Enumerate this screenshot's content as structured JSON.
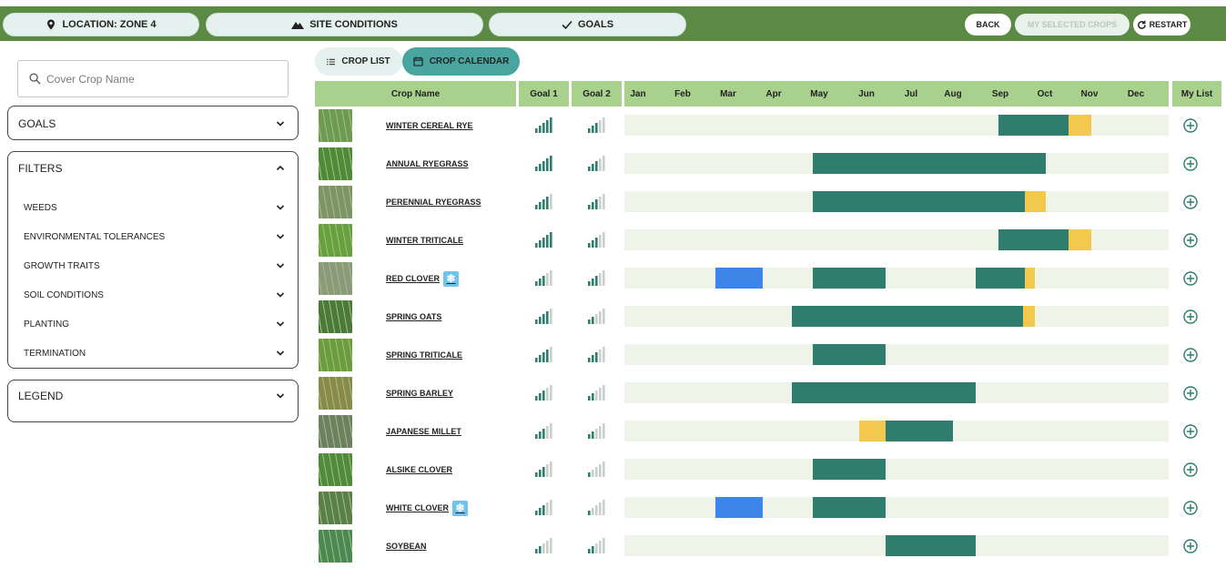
{
  "topbar": {
    "location_label": "LOCATION: ZONE 4",
    "site_conditions_label": "SITE CONDITIONS",
    "goals_label": "GOALS",
    "back_label": "BACK",
    "my_selected_crops_label": "MY SELECTED CROPS",
    "restart_label": "RESTART"
  },
  "sidebar": {
    "search_placeholder": "Cover Crop Name",
    "goals_label": "GOALS",
    "filters_label": "FILTERS",
    "filters": [
      "WEEDS",
      "ENVIRONMENTAL TOLERANCES",
      "GROWTH TRAITS",
      "SOIL CONDITIONS",
      "PLANTING",
      "TERMINATION"
    ],
    "legend_label": "LEGEND"
  },
  "view_tabs": {
    "crop_list": "CROP LIST",
    "crop_calendar": "CROP CALENDAR",
    "active": "crop_calendar"
  },
  "table": {
    "headers": {
      "crop_name": "Crop Name",
      "goal1": "Goal 1",
      "goal2": "Goal 2",
      "my_list": "My List"
    },
    "months": [
      "Jan",
      "Feb",
      "Mar",
      "Apr",
      "May",
      "Jun",
      "Jul",
      "Aug",
      "Sep",
      "Oct",
      "Nov",
      "Dec"
    ],
    "colors": {
      "growing": "#2e7d6f",
      "reliable_establishment": "#f2c94c",
      "frost_seeding": "#3d85e8",
      "track": "#eef5e8"
    },
    "crops": [
      {
        "name": "WINTER CEREAL RYE",
        "frost": false,
        "goal1": 5,
        "goal2": 3,
        "thumb": "#6f9a52",
        "segments": [
          {
            "type": "growing",
            "start": 8.25,
            "end": 9.8
          },
          {
            "type": "reliable_establishment",
            "start": 9.8,
            "end": 10.3
          }
        ]
      },
      {
        "name": "ANNUAL RYEGRASS",
        "frost": false,
        "goal1": 5,
        "goal2": 3,
        "thumb": "#4e8a37",
        "segments": [
          {
            "type": "growing",
            "start": 4.15,
            "end": 9.3
          }
        ]
      },
      {
        "name": "PERENNIAL RYEGRASS",
        "frost": false,
        "goal1": 4,
        "goal2": 3,
        "thumb": "#7f9368",
        "segments": [
          {
            "type": "growing",
            "start": 4.15,
            "end": 8.82
          },
          {
            "type": "reliable_establishment",
            "start": 8.82,
            "end": 9.3
          }
        ]
      },
      {
        "name": "WINTER TRITICALE",
        "frost": false,
        "goal1": 5,
        "goal2": 3,
        "thumb": "#67a13c",
        "segments": [
          {
            "type": "growing",
            "start": 8.25,
            "end": 9.8
          },
          {
            "type": "reliable_establishment",
            "start": 9.8,
            "end": 10.3
          }
        ]
      },
      {
        "name": "RED CLOVER",
        "frost": true,
        "goal1": 3,
        "goal2": 3,
        "thumb": "#8b9a7a",
        "segments": [
          {
            "type": "frost_seeding",
            "start": 2.0,
            "end": 3.05
          },
          {
            "type": "growing",
            "start": 4.15,
            "end": 5.75
          },
          {
            "type": "growing",
            "start": 7.75,
            "end": 8.82
          },
          {
            "type": "reliable_establishment",
            "start": 8.82,
            "end": 9.05
          }
        ]
      },
      {
        "name": "SPRING OATS",
        "frost": false,
        "goal1": 4,
        "goal2": 2,
        "thumb": "#4a7a3a",
        "segments": [
          {
            "type": "growing",
            "start": 3.7,
            "end": 8.78
          },
          {
            "type": "reliable_establishment",
            "start": 8.78,
            "end": 9.05
          }
        ]
      },
      {
        "name": "SPRING TRITICALE",
        "frost": false,
        "goal1": 4,
        "goal2": 3,
        "thumb": "#6c9c3d",
        "segments": [
          {
            "type": "growing",
            "start": 4.15,
            "end": 5.75
          }
        ]
      },
      {
        "name": "SPRING BARLEY",
        "frost": false,
        "goal1": 3,
        "goal2": 2,
        "thumb": "#8a8a4a",
        "segments": [
          {
            "type": "growing",
            "start": 3.7,
            "end": 7.75
          }
        ]
      },
      {
        "name": "JAPANESE MILLET",
        "frost": false,
        "goal1": 3,
        "goal2": 2,
        "thumb": "#6e7f62",
        "segments": [
          {
            "type": "reliable_establishment",
            "start": 5.18,
            "end": 5.75
          },
          {
            "type": "growing",
            "start": 5.75,
            "end": 7.25
          }
        ]
      },
      {
        "name": "ALSIKE CLOVER",
        "frost": false,
        "goal1": 3,
        "goal2": 1,
        "thumb": "#4f8a3e",
        "segments": [
          {
            "type": "growing",
            "start": 4.15,
            "end": 5.75
          }
        ]
      },
      {
        "name": "WHITE CLOVER",
        "frost": true,
        "goal1": 3,
        "goal2": 1,
        "thumb": "#5a7f4a",
        "segments": [
          {
            "type": "frost_seeding",
            "start": 2.0,
            "end": 3.05
          },
          {
            "type": "growing",
            "start": 4.15,
            "end": 5.75
          }
        ]
      },
      {
        "name": "SOYBEAN",
        "frost": false,
        "goal1": 2,
        "goal2": 2,
        "thumb": "#4a8a52",
        "segments": [
          {
            "type": "growing",
            "start": 5.75,
            "end": 7.75
          }
        ]
      }
    ]
  }
}
